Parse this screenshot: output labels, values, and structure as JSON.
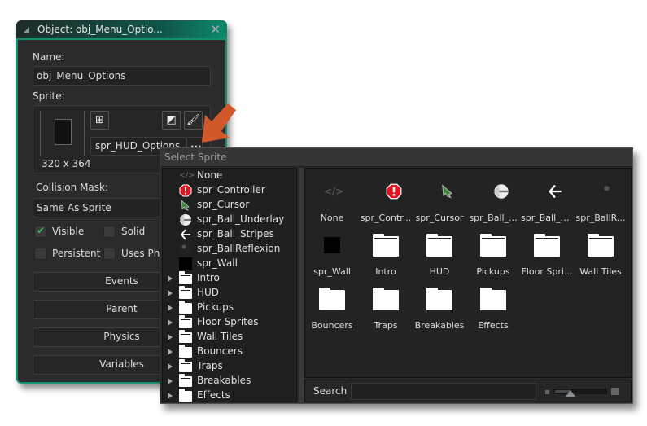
{
  "object_window": {
    "title": "Object: obj_Menu_Optio...",
    "name_label": "Name:",
    "name_value": "obj_Menu_Options",
    "sprite_label": "Sprite:",
    "sprite_size": "320 x 364",
    "sprite_value": "spr_HUD_Options...",
    "browse_label": "...",
    "collision_label": "Collision Mask:",
    "collision_value": "Same As Sprite",
    "checkboxes": [
      {
        "label": "Visible",
        "checked": true
      },
      {
        "label": "Solid",
        "checked": false
      },
      {
        "label": "Persistent",
        "checked": false
      },
      {
        "label": "Uses Phy",
        "checked": false
      }
    ],
    "buttons": [
      "Events",
      "Parent",
      "Physics",
      "Variables"
    ],
    "accent": "#109070"
  },
  "arrow_color": "#d0582a",
  "select_sprite": {
    "title": "Select Sprite",
    "tree": [
      {
        "label": "None",
        "icon": "code-icon"
      },
      {
        "label": "spr_Controller",
        "icon": "warning-icon"
      },
      {
        "label": "spr_Cursor",
        "icon": "cursor-icon"
      },
      {
        "label": "spr_Ball_Underlay",
        "icon": "ball-underlay-icon"
      },
      {
        "label": "spr_Ball_Stripes",
        "icon": "arrow-left-icon"
      },
      {
        "label": "spr_BallReflexion",
        "icon": "ball-icon"
      },
      {
        "label": "spr_Wall",
        "icon": "wall-icon"
      },
      {
        "label": "Intro",
        "icon": "folder-icon"
      },
      {
        "label": "HUD",
        "icon": "folder-icon"
      },
      {
        "label": "Pickups",
        "icon": "folder-icon"
      },
      {
        "label": "Floor Sprites",
        "icon": "folder-icon"
      },
      {
        "label": "Wall Tiles",
        "icon": "folder-icon"
      },
      {
        "label": "Bouncers",
        "icon": "folder-icon"
      },
      {
        "label": "Traps",
        "icon": "folder-icon"
      },
      {
        "label": "Breakables",
        "icon": "folder-icon"
      },
      {
        "label": "Effects",
        "icon": "folder-icon"
      }
    ],
    "grid": [
      {
        "label": "None",
        "icon": "code-icon"
      },
      {
        "label": "spr_Contr...",
        "icon": "warning-icon"
      },
      {
        "label": "spr_Cursor",
        "icon": "cursor-icon"
      },
      {
        "label": "spr_Ball_...",
        "icon": "ball-underlay-icon"
      },
      {
        "label": "spr_Ball_S...",
        "icon": "arrow-left-icon"
      },
      {
        "label": "spr_BallR...",
        "icon": "ball-icon"
      },
      {
        "label": "spr_Wall",
        "icon": "wall-icon"
      },
      {
        "label": "Intro",
        "icon": "folder-icon"
      },
      {
        "label": "HUD",
        "icon": "folder-icon"
      },
      {
        "label": "Pickups",
        "icon": "folder-icon"
      },
      {
        "label": "Floor Spri...",
        "icon": "folder-icon"
      },
      {
        "label": "Wall Tiles",
        "icon": "folder-icon"
      },
      {
        "label": "Bouncers",
        "icon": "folder-icon"
      },
      {
        "label": "Traps",
        "icon": "folder-icon"
      },
      {
        "label": "Breakables",
        "icon": "folder-icon"
      },
      {
        "label": "Effects",
        "icon": "folder-icon"
      }
    ],
    "search_label": "Search",
    "search_value": "",
    "zoom_level": 0.3
  }
}
